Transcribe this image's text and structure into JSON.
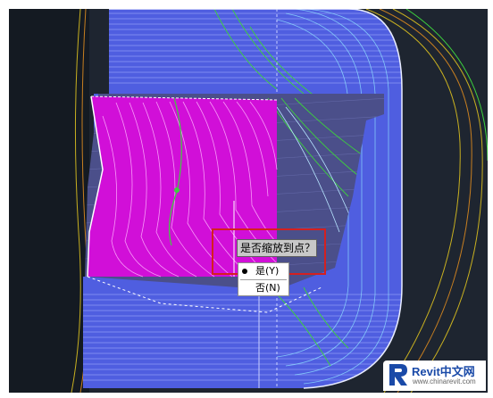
{
  "prompt": {
    "question": "是否缩放到点？"
  },
  "options": [
    {
      "label": "是(Y)",
      "selected": true
    },
    {
      "label": "否(N)",
      "selected": false
    }
  ],
  "watermark": {
    "brand": "Revit中文网",
    "url": "www.chinarevit.com"
  },
  "colors": {
    "canvas": "#1e2530",
    "highlight": "#d42020",
    "selection_fill": "#d10fd8",
    "road": "#5a6ee8",
    "contour_green": "#3dd13d",
    "contour_yellow": "#c8b020"
  }
}
